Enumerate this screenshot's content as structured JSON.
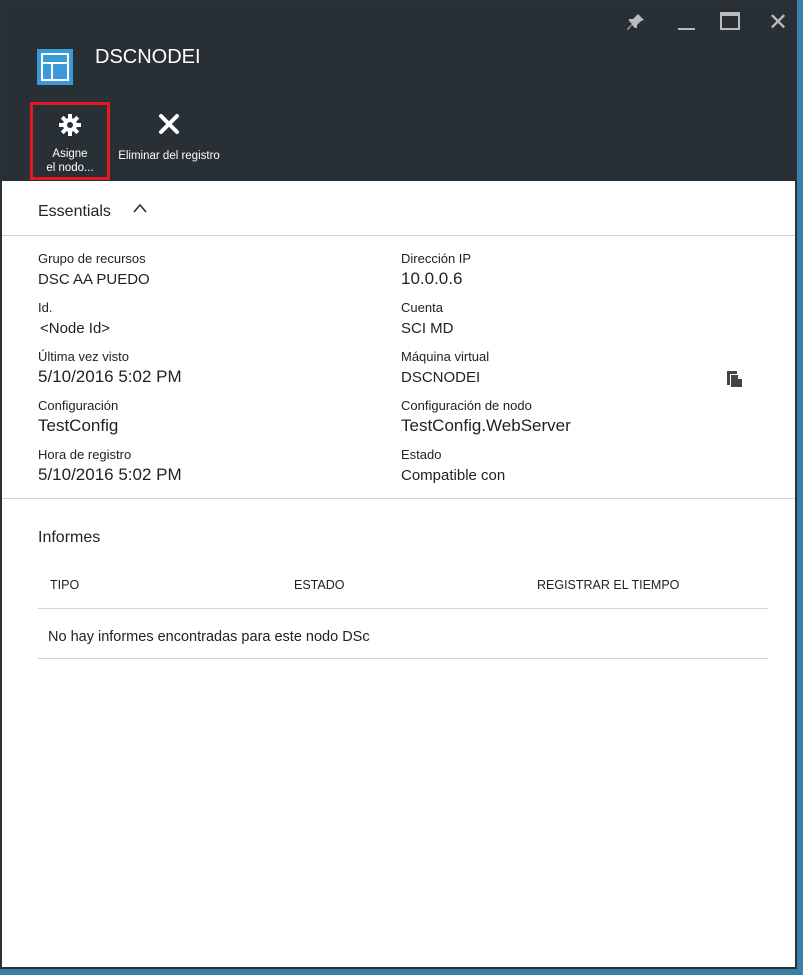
{
  "header": {
    "title": "DSCNODEI",
    "window_controls": [
      "pin-icon",
      "minimize-icon",
      "maximize-icon",
      "close-icon"
    ],
    "commands": [
      {
        "icon": "gear-icon",
        "label_line1": "Asigne",
        "label_line2": "el nodo..."
      },
      {
        "icon": "x-icon",
        "label_line1": "Eliminar del registro"
      }
    ],
    "bg_color": "#283036",
    "highlight_color": "#e3191f"
  },
  "essentials": {
    "label": "Essentials",
    "chevron": "^",
    "left": [
      {
        "label": "Grupo de recursos",
        "value": "DSC AA PUEDO"
      },
      {
        "label": "Id.",
        "value": "<Node Id>"
      },
      {
        "label": "Última vez visto",
        "value": "5/10/2016 5:02 PM"
      },
      {
        "label": "Configuración",
        "value": "TestConfig"
      },
      {
        "label": "Hora de registro",
        "value": "5/10/2016 5:02 PM"
      }
    ],
    "right": [
      {
        "label": "Dirección IP",
        "value": "10.0.0.6"
      },
      {
        "label": "Cuenta",
        "value": "SCI MD"
      },
      {
        "label": "Máquina virtual",
        "value": "DSCNODEI"
      },
      {
        "label": "Configuración de nodo",
        "value": "TestConfig.WebServer"
      },
      {
        "label": "Estado",
        "value": "Compatible con"
      }
    ]
  },
  "reports": {
    "title": "Informes",
    "columns": [
      "TIPO",
      "ESTADO",
      "REGISTRAR EL TIEMPO"
    ],
    "empty_message": "No hay informes encontradas para este nodo DSc"
  }
}
